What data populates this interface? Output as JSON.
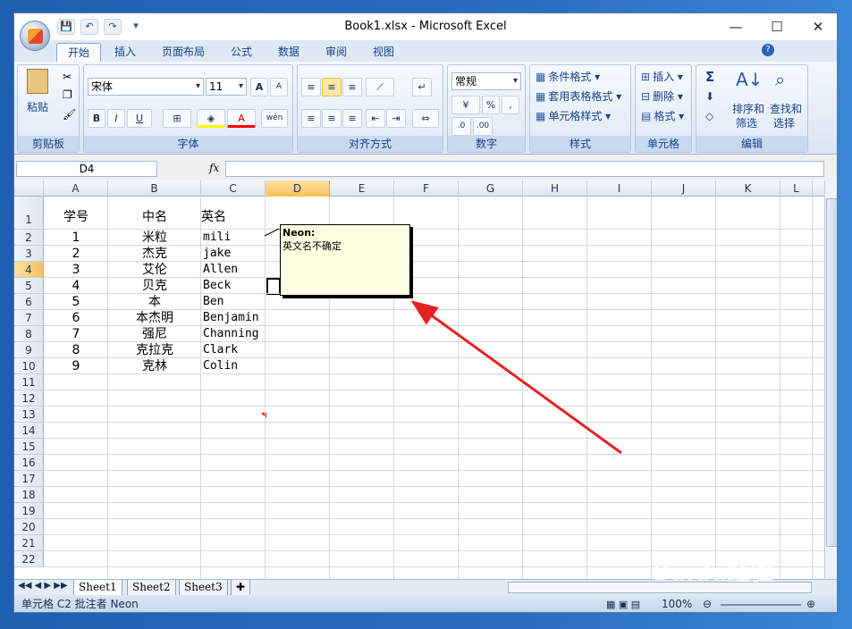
{
  "window": {
    "title": "Book1.xlsx - Microsoft Excel",
    "minimize": "—",
    "maximize": "☐",
    "close": "✕"
  },
  "qat": {
    "save": "💾",
    "undo": "↶",
    "redo": "↷",
    "more": "▾"
  },
  "tabs": [
    "开始",
    "插入",
    "页面布局",
    "公式",
    "数据",
    "审阅",
    "视图"
  ],
  "ribbon": {
    "clipboard": {
      "label": "剪贴板",
      "paste": "粘贴"
    },
    "font": {
      "label": "字体",
      "name": "宋体",
      "size": "11",
      "bold": "B",
      "italic": "I",
      "underline": "U",
      "grow": "A",
      "shrink": "A",
      "wen": "wén"
    },
    "align": {
      "label": "对齐方式"
    },
    "number": {
      "label": "数字",
      "format": "常规",
      "percent": "%",
      "comma": ","
    },
    "styles": {
      "label": "样式",
      "cond": "条件格式",
      "table": "套用表格格式",
      "cell": "单元格样式"
    },
    "cells": {
      "label": "单元格",
      "insert": "插入",
      "delete": "删除",
      "format": "格式"
    },
    "edit": {
      "label": "编辑",
      "sigma": "Σ",
      "sort": "排序和",
      "sort2": "筛选",
      "find": "查找和",
      "find2": "选择"
    }
  },
  "formula": {
    "namebox": "D4",
    "fx": "fx",
    "value": ""
  },
  "columns": [
    "A",
    "B",
    "C",
    "D",
    "E",
    "F",
    "G",
    "H",
    "I",
    "J",
    "K",
    "L"
  ],
  "rows": [
    "1",
    "2",
    "3",
    "4",
    "5",
    "6",
    "7",
    "8",
    "9",
    "10",
    "11",
    "12",
    "13",
    "14",
    "15",
    "16",
    "17",
    "18",
    "19",
    "20",
    "21",
    "22"
  ],
  "headers": {
    "a": "学号",
    "b": "中名",
    "c": "英名"
  },
  "data": [
    {
      "a": "1",
      "b": "米粒",
      "c": "mili"
    },
    {
      "a": "2",
      "b": "杰克",
      "c": "jake"
    },
    {
      "a": "3",
      "b": "艾伦",
      "c": "Allen"
    },
    {
      "a": "4",
      "b": "贝克",
      "c": "Beck"
    },
    {
      "a": "5",
      "b": "本",
      "c": "Ben"
    },
    {
      "a": "6",
      "b": "本杰明",
      "c": "Benjamin"
    },
    {
      "a": "7",
      "b": "强尼",
      "c": "Channing"
    },
    {
      "a": "8",
      "b": "克拉克",
      "c": "Clark"
    },
    {
      "a": "9",
      "b": "克林",
      "c": "Colin"
    }
  ],
  "comment": {
    "author": "Neon:",
    "text": "英文名不确定"
  },
  "sheets": [
    "Sheet1",
    "Sheet2",
    "Sheet3"
  ],
  "status": {
    "text": "单元格 C2 批注者 Neon",
    "zoom": "100%"
  },
  "watermark": "Baidu经验"
}
